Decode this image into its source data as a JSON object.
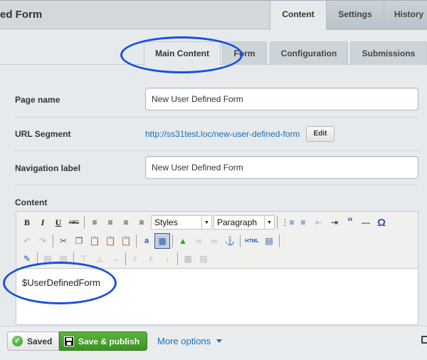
{
  "header": {
    "title": "ed Form",
    "tabs": [
      {
        "label": "Content",
        "active": true
      },
      {
        "label": "Settings",
        "active": false
      },
      {
        "label": "History",
        "active": false
      }
    ]
  },
  "subtabs": [
    {
      "label": "Main Content",
      "active": true
    },
    {
      "label": "Form",
      "active": false
    },
    {
      "label": "Configuration",
      "active": false
    },
    {
      "label": "Submissions",
      "active": false
    }
  ],
  "fields": {
    "page_name": {
      "label": "Page name",
      "value": "New User Defined Form"
    },
    "url_segment": {
      "label": "URL Segment",
      "url": "http://ss31test.loc/new-user-defined-form",
      "edit_label": "Edit"
    },
    "nav_label": {
      "label": "Navigation label",
      "value": "New User Defined Form"
    }
  },
  "content": {
    "label": "Content",
    "styles_select": "Styles",
    "format_select": "Paragraph",
    "html_label": "HTML",
    "body_text": "$UserDefinedForm"
  },
  "footer": {
    "saved_label": "Saved",
    "publish_label": "Save & publish",
    "more_options_label": "More options"
  },
  "colors": {
    "link": "#1a6fb5",
    "publish_green": "#4aa32f",
    "annotation_blue": "#1a4fe0"
  }
}
